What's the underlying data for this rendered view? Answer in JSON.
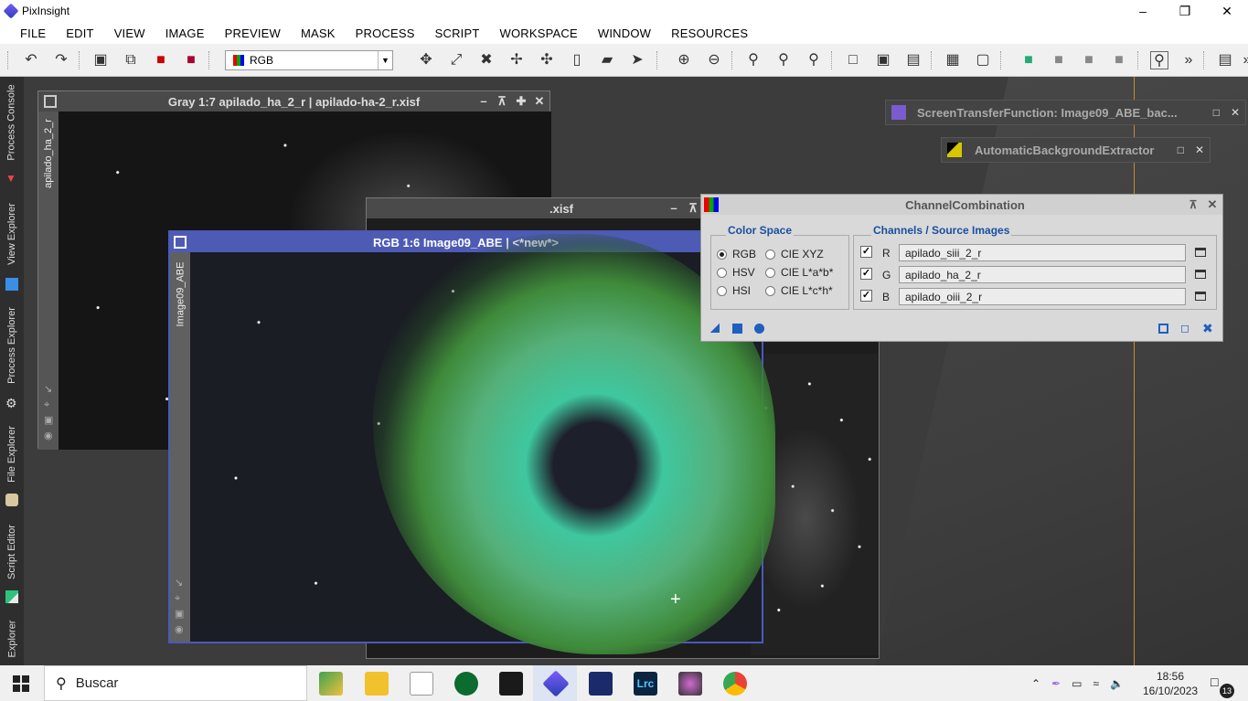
{
  "app": {
    "title": "PixInsight"
  },
  "menu": [
    "FILE",
    "EDIT",
    "VIEW",
    "IMAGE",
    "PREVIEW",
    "MASK",
    "PROCESS",
    "SCRIPT",
    "WORKSPACE",
    "WINDOW",
    "RESOURCES"
  ],
  "toolbar": {
    "color_mode": "RGB"
  },
  "sidebar": {
    "tabs": [
      "Process Console",
      "View Explorer",
      "Process Explorer",
      "File Explorer",
      "Script Editor",
      "Explorer"
    ]
  },
  "gray_window": {
    "title": "Gray 1:7 apilado_ha_2_r | apilado-ha-2_r.xisf",
    "tab": "apilado_ha_2_r"
  },
  "hidden_window": {
    "title_fragment": ".xisf"
  },
  "rgb_window": {
    "title": "RGB 1:6 Image09_ABE | <*new*>",
    "tab": "Image09_ABE"
  },
  "stf_window": {
    "title": "ScreenTransferFunction: Image09_ABE_bac..."
  },
  "abe_window": {
    "title": "AutomaticBackgroundExtractor"
  },
  "channel_combination": {
    "title": "ChannelCombination",
    "color_space": {
      "label": "Color Space",
      "options": [
        "RGB",
        "HSV",
        "HSI",
        "CIE XYZ",
        "CIE L*a*b*",
        "CIE L*c*h*"
      ],
      "selected": "RGB"
    },
    "channels": {
      "label": "Channels / Source Images",
      "rows": [
        {
          "channel": "R",
          "checked": true,
          "source": "apilado_siii_2_r"
        },
        {
          "channel": "G",
          "checked": true,
          "source": "apilado_ha_2_r"
        },
        {
          "channel": "B",
          "checked": true,
          "source": "apilado_oiii_2_r"
        }
      ]
    }
  },
  "taskbar": {
    "search_placeholder": "Buscar",
    "time": "18:56",
    "date": "16/10/2023",
    "notifications": "13"
  }
}
